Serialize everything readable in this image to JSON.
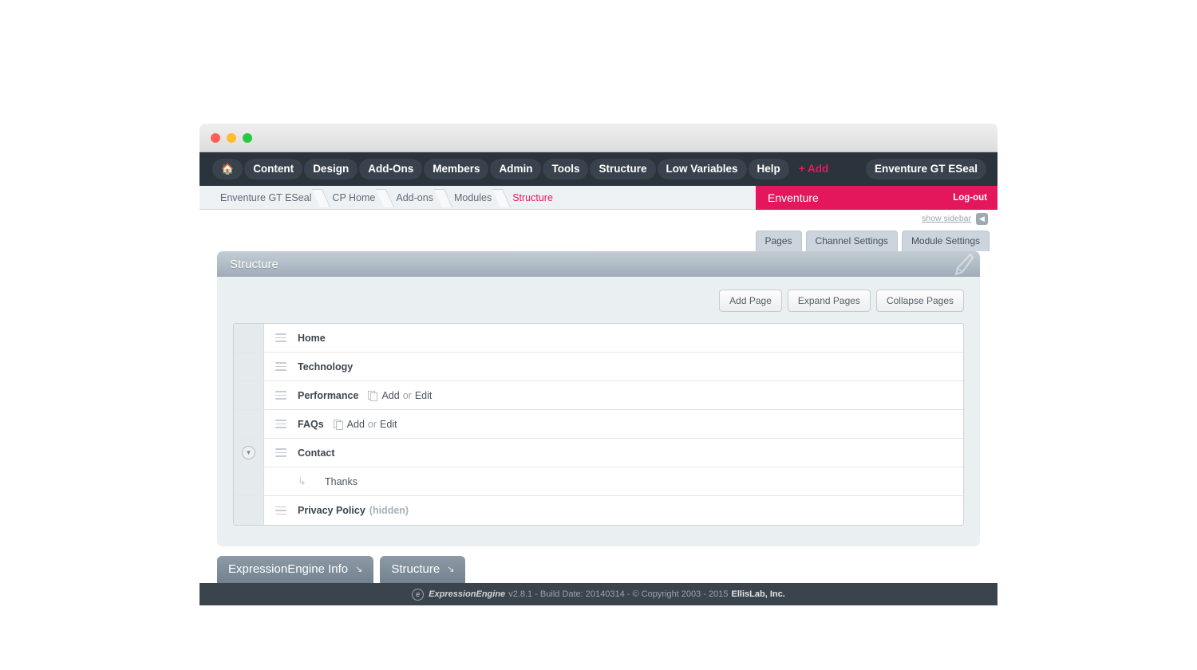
{
  "window": {
    "traffic_lights": [
      "close",
      "minimize",
      "zoom"
    ]
  },
  "topnav": {
    "home_icon": "home-icon",
    "items": [
      {
        "label": "Content"
      },
      {
        "label": "Design"
      },
      {
        "label": "Add-Ons"
      },
      {
        "label": "Members"
      },
      {
        "label": "Admin"
      },
      {
        "label": "Tools"
      },
      {
        "label": "Structure"
      },
      {
        "label": "Low Variables"
      },
      {
        "label": "Help"
      }
    ],
    "add_label": "+ Add",
    "user_label": "Enventure GT ESeal",
    "accent_color": "#e8195e",
    "background_color": "#2b333c"
  },
  "breadcrumb": {
    "items": [
      {
        "label": "Enventure GT ESeal",
        "active": false
      },
      {
        "label": "CP Home",
        "active": false
      },
      {
        "label": "Add-ons",
        "active": false
      },
      {
        "label": "Modules",
        "active": false
      },
      {
        "label": "Structure",
        "active": true
      }
    ]
  },
  "site_bar": {
    "site_name": "Enventure",
    "logout_label": "Log-out",
    "color": "#e4175c"
  },
  "sidebar_toggle": {
    "label": "show sidebar",
    "icon": "sidebar-icon"
  },
  "module_tabs": [
    {
      "label": "Pages",
      "active": true
    },
    {
      "label": "Channel Settings",
      "active": false
    },
    {
      "label": "Module Settings",
      "active": false
    }
  ],
  "panel": {
    "title": "Structure",
    "edit_icon": "pencil-icon",
    "actions": [
      {
        "label": "Add Page"
      },
      {
        "label": "Expand Pages"
      },
      {
        "label": "Collapse Pages"
      }
    ]
  },
  "tree": {
    "add_label": "Add",
    "or_label": "or",
    "edit_label": "Edit",
    "rows": [
      {
        "name": "Home",
        "child": false,
        "toggle": false,
        "hidden_tag": "",
        "has_addedit": false
      },
      {
        "name": "Technology",
        "child": false,
        "toggle": false,
        "hidden_tag": "",
        "has_addedit": false
      },
      {
        "name": "Performance",
        "child": false,
        "toggle": false,
        "hidden_tag": "",
        "has_addedit": true
      },
      {
        "name": "FAQs",
        "child": false,
        "toggle": false,
        "hidden_tag": "",
        "has_addedit": true
      },
      {
        "name": "Contact",
        "child": false,
        "toggle": true,
        "hidden_tag": "",
        "has_addedit": false
      },
      {
        "name": "Thanks",
        "child": true,
        "toggle": false,
        "hidden_tag": "",
        "has_addedit": false
      },
      {
        "name": "Privacy Policy",
        "child": false,
        "toggle": false,
        "hidden_tag": "(hidden)",
        "has_addedit": false
      }
    ]
  },
  "bottom_tabs": [
    {
      "label": "ExpressionEngine Info",
      "caret": "↘"
    },
    {
      "label": "Structure",
      "caret": "↘"
    }
  ],
  "footer": {
    "product": "ExpressionEngine",
    "details": "v2.8.1 - Build Date: 20140314 - © Copyright 2003 - 2015",
    "company": "EllisLab, Inc."
  }
}
